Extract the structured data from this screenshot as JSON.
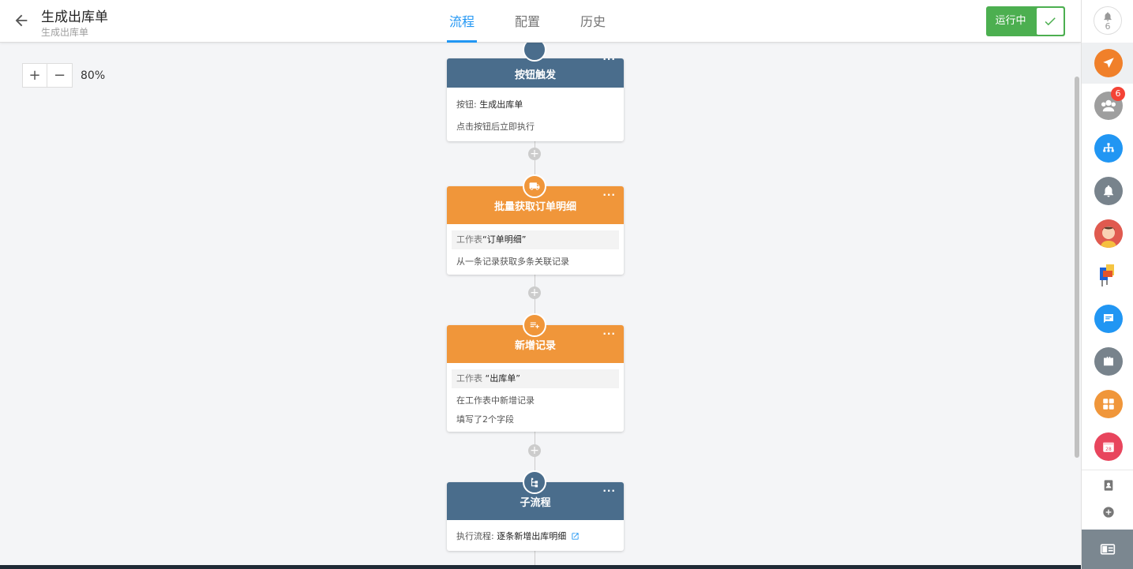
{
  "header": {
    "title": "生成出库单",
    "subtitle": "生成出库单",
    "tabs": [
      "流程",
      "配置",
      "历史"
    ],
    "active_tab": "流程",
    "status_label": "运行中",
    "accent_color": "#2196f3",
    "status_color": "#4caf50"
  },
  "zoom": {
    "plus": "+",
    "minus": "−",
    "level": "80%"
  },
  "flow": {
    "add_symbol": "+",
    "more_symbol": "···",
    "nodes": [
      {
        "title": "按钮触发",
        "color": "#4a6d8c",
        "icon": "cursor-icon",
        "field_label": "按钮:",
        "field_value": "生成出库单",
        "desc": "点击按钮后立即执行"
      },
      {
        "title": "批量获取订单明细",
        "color": "#f0963a",
        "icon": "truck-icon",
        "field_label": "工作表",
        "field_value": "“订单明细”",
        "desc": "从一条记录获取多条关联记录"
      },
      {
        "title": "新增记录",
        "color": "#f0963a",
        "icon": "add-list-icon",
        "field_label": "工作表",
        "field_value": "“出库单”",
        "desc": "在工作表中新增记录",
        "desc2": "填写了2个字段"
      },
      {
        "title": "子流程",
        "color": "#4a6d8c",
        "icon": "subprocess-icon",
        "field_label": "执行流程:",
        "field_value": "逐条新增出库明细",
        "link_icon": "external-link-icon"
      }
    ]
  },
  "sidebar": {
    "notification_count": "6",
    "contacts_badge": "6",
    "calendar_day": "28",
    "icons": [
      "bell-icon",
      "send-icon",
      "contacts-icon",
      "org-chart-icon",
      "reminder-icon",
      "avatar",
      "app-icon",
      "chat-icon",
      "briefcase-icon",
      "apps-grid-icon",
      "calendar-icon",
      "address-book-icon",
      "add-chat-icon",
      "collapse-icon"
    ]
  }
}
